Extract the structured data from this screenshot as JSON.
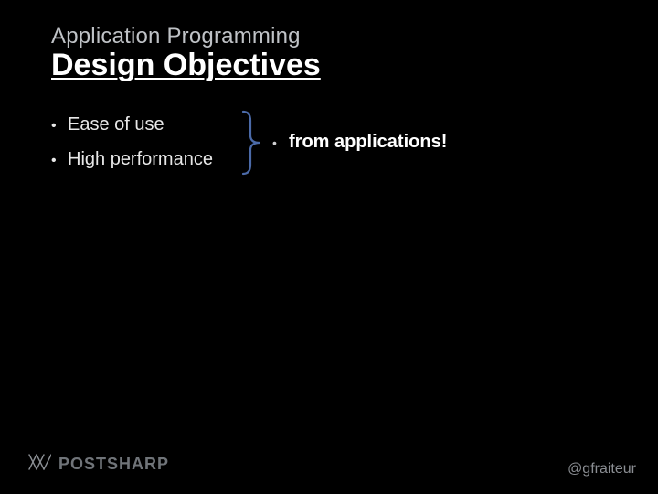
{
  "pretitle": "Application Programming",
  "title": "Design Objectives",
  "left_items": [
    {
      "text": "Ease of use"
    },
    {
      "text": "High performance"
    }
  ],
  "right_item": {
    "text": "from applications!"
  },
  "logo_text": "POSTSHARP",
  "handle": "@gfraiteur",
  "colors": {
    "bracket": "#4b6aa8"
  }
}
